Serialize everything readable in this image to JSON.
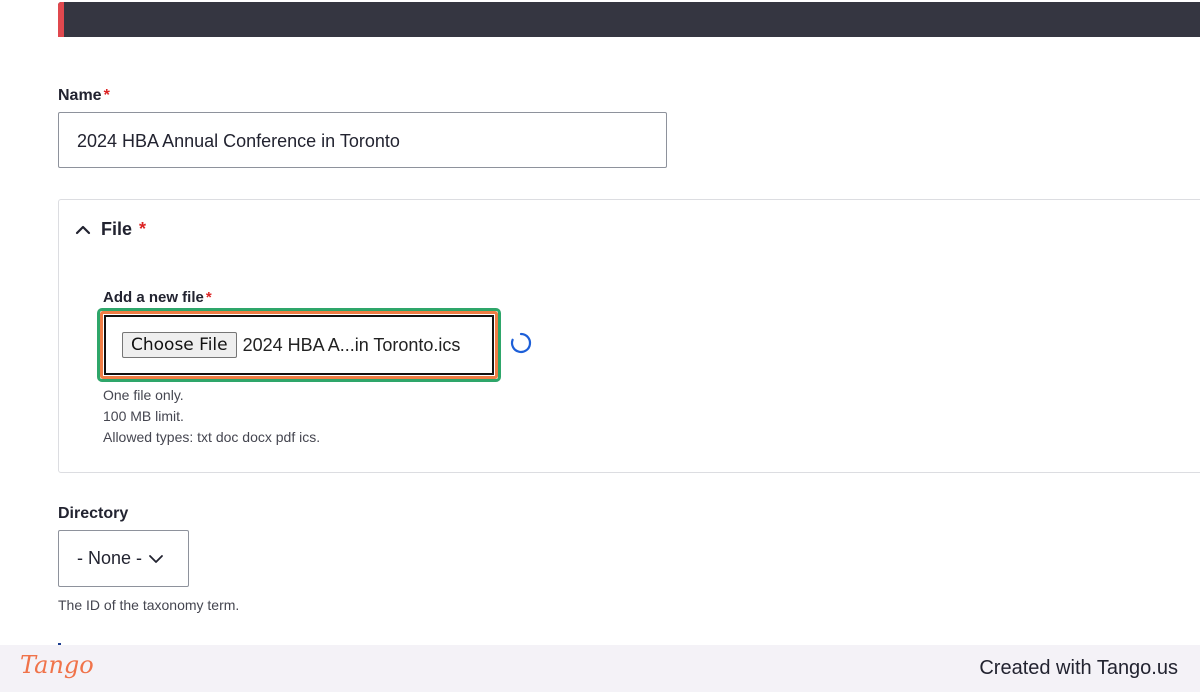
{
  "form": {
    "name_label": "Name",
    "required_mark": "*",
    "name_value": "2024 HBA Annual Conference in Toronto",
    "file_section_title": "File",
    "add_file_label": "Add a new file",
    "choose_file_label": "Choose File",
    "chosen_file_name": "2024 HBA A...in Toronto.ics",
    "help": {
      "line1": "One file only.",
      "line2": "100 MB limit.",
      "line3": "Allowed types: txt doc docx pdf ics."
    },
    "directory_label": "Directory",
    "directory_value": "- None -",
    "directory_help": "The ID of the taxonomy term."
  },
  "footer": {
    "logo": "Tango",
    "credit": "Created with Tango.us"
  },
  "colors": {
    "topbar": "#353641",
    "topbar_accent": "#e0484e",
    "required": "#dc2323",
    "highlight_outer": "#2ea66a",
    "highlight_inner": "#f07d45",
    "spinner": "#1d5fd8",
    "brand": "#f0734a"
  },
  "icons": {
    "section_toggle": "chevron-up-icon",
    "select_arrow": "chevron-down-icon",
    "loading": "spinner-icon"
  }
}
